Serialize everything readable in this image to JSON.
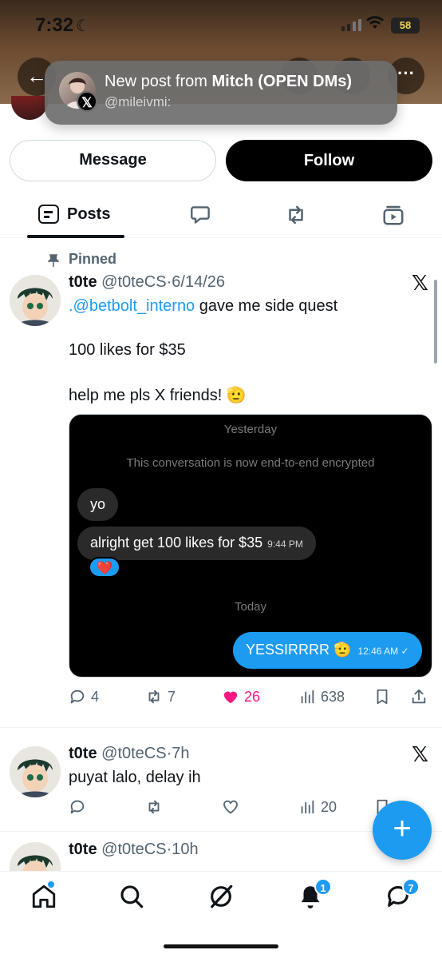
{
  "status_bar": {
    "time": "7:32",
    "battery": "58"
  },
  "notification": {
    "title_prefix": "New post from ",
    "title_name": "Mitch (OPEN DMs)",
    "handle": "@mileivmi:",
    "app_badge": "𝕏"
  },
  "profile_actions": {
    "message_label": "Message",
    "follow_label": "Follow"
  },
  "tabs": {
    "posts_label": "Posts"
  },
  "pinned_label": "Pinned",
  "posts": [
    {
      "name": "t0te",
      "handle": "@t0teCS",
      "sep": "·",
      "date": "6/14/26",
      "text_link": ".@betbolt_interno",
      "text_line1_rest": " gave me side quest",
      "text_line2": "100 likes for $35",
      "text_line3": "help me pls X friends! 🫡",
      "embed": {
        "yesterday": "Yesterday",
        "encrypted_notice": "This conversation is now end-to-end encrypted",
        "msg1": "yo",
        "msg2": "alright get 100 likes for $35",
        "msg2_time": "9:44 PM",
        "reaction": "❤️",
        "today": "Today",
        "reply": "YESSIRRRR 🫡",
        "reply_time": "12:46 AM ✓"
      },
      "replies": "4",
      "reposts": "7",
      "likes": "26",
      "views": "638"
    },
    {
      "name": "t0te",
      "handle": "@t0teCS",
      "sep": "·",
      "date": "7h",
      "text": "puyat lalo, delay ih",
      "views": "20"
    },
    {
      "name": "t0te",
      "handle": "@t0teCS",
      "sep": "·",
      "date": "10h"
    }
  ],
  "x_logo": "𝕏",
  "fab_label": "+",
  "nav": {
    "notifications_badge": "1",
    "messages_badge": "7"
  },
  "colors": {
    "accent": "#1d9bf0",
    "like": "#f91880",
    "text": "#0f1419",
    "muted": "#536471"
  }
}
